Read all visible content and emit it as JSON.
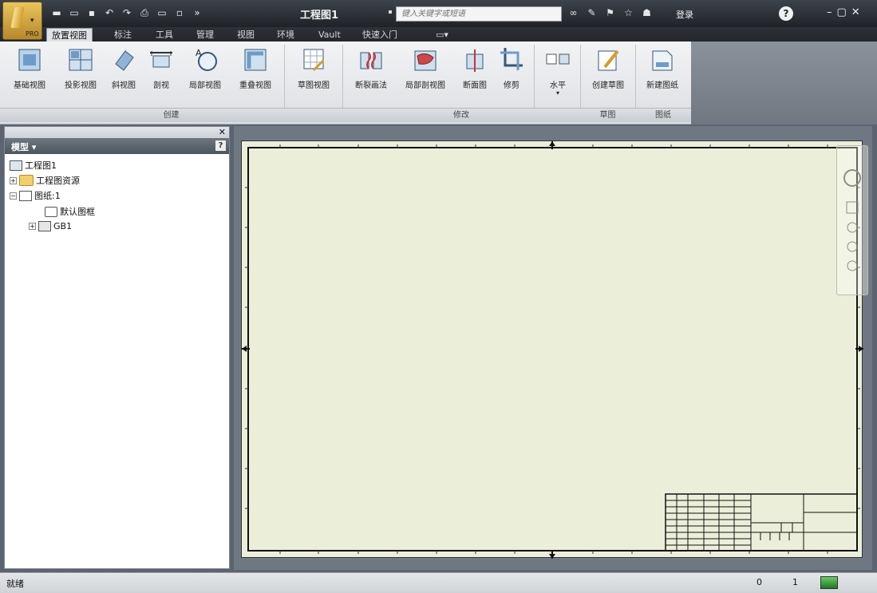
{
  "app": {
    "badge": "PRO"
  },
  "window": {
    "title": "工程图1"
  },
  "search": {
    "placeholder": "键入关键字或短语"
  },
  "login": {
    "label": "登录"
  },
  "help": {
    "label": "?"
  },
  "tabs": [
    {
      "label": "放置视图",
      "active": true
    },
    {
      "label": "标注"
    },
    {
      "label": "工具"
    },
    {
      "label": "管理"
    },
    {
      "label": "视图"
    },
    {
      "label": "环境"
    },
    {
      "label": "Vault"
    },
    {
      "label": "快速入门"
    }
  ],
  "ribbon": {
    "buttons": [
      {
        "label": "基础视图",
        "icon": "base-view-icon"
      },
      {
        "label": "投影视图",
        "icon": "projected-view-icon"
      },
      {
        "label": "斜视图",
        "icon": "auxiliary-view-icon"
      },
      {
        "label": "剖视",
        "icon": "section-view-icon"
      },
      {
        "label": "局部视图",
        "icon": "detail-view-icon"
      },
      {
        "label": "重叠视图",
        "icon": "overlay-view-icon"
      },
      {
        "label": "草图视图",
        "icon": "draft-view-icon"
      },
      {
        "label": "断裂画法",
        "icon": "break-icon"
      },
      {
        "label": "局部剖视图",
        "icon": "breakout-icon"
      },
      {
        "label": "断面图",
        "icon": "slice-icon"
      },
      {
        "label": "修剪",
        "icon": "crop-icon"
      },
      {
        "label": "水平",
        "icon": "horizontal-icon"
      },
      {
        "label": "创建草图",
        "icon": "create-sketch-icon"
      },
      {
        "label": "新建图纸",
        "icon": "new-sheet-icon"
      }
    ],
    "panels": [
      "创建",
      "修改",
      "草图",
      "图纸"
    ]
  },
  "browser": {
    "title": "模型",
    "help": "?",
    "tree": [
      {
        "label": "工程图1"
      },
      {
        "label": "工程图资源"
      },
      {
        "label": "图纸:1"
      },
      {
        "label": "默认图框"
      },
      {
        "label": "GB1"
      }
    ]
  },
  "status": {
    "text": "就绪",
    "count_a": "0",
    "count_b": "1"
  },
  "colors": {
    "sheet": "#ebeed9",
    "ribbon": "#e7e9ec",
    "titlebar": "#2a2f35"
  }
}
